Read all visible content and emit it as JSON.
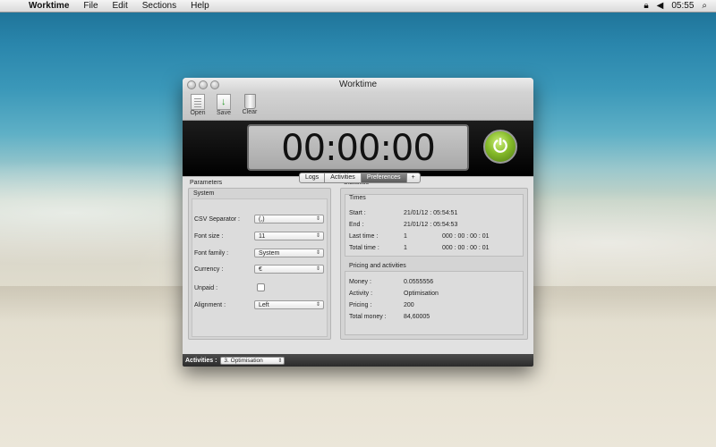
{
  "menubar": {
    "apple": "",
    "app_name": "Worktime",
    "items": [
      "File",
      "Edit",
      "Sections",
      "Help"
    ],
    "time": "05:55",
    "lock_icon": "lock-icon",
    "speaker_icon": "speaker-icon",
    "search_icon": "search-icon"
  },
  "window": {
    "title": "Worktime",
    "toolbar": {
      "open": "Open",
      "save": "Save",
      "clear": "Clear"
    },
    "timer": "00:00:00",
    "tabs": [
      "Logs",
      "Activities",
      "Preferences",
      "+"
    ],
    "parameters": {
      "title": "Parameters",
      "group": "System",
      "csv_label": "CSV Separator :",
      "csv_value": "(,)",
      "font_size_label": "Font size :",
      "font_size_value": "11",
      "font_family_label": "Font family :",
      "font_family_value": "System",
      "currency_label": "Currency :",
      "currency_value": "€",
      "unpaid_label": "Unpaid :",
      "alignment_label": "Alignment :",
      "alignment_value": "Left"
    },
    "statistics": {
      "title": "Statistics",
      "times_title": "Times",
      "start_label": "Start :",
      "start_value": "21/01/12 : 05:54:51",
      "end_label": "End :",
      "end_value": "21/01/12 : 05:54:53",
      "last_label": "Last time :",
      "last_count": "1",
      "last_value": "000 : 00 : 00 : 01",
      "total_label": "Total time :",
      "total_count": "1",
      "total_value": "000 : 00 : 00 : 01",
      "pricing_title": "Pricing and activities",
      "money_label": "Money :",
      "money_value": "0.0555556",
      "activity_label": "Activity :",
      "activity_value": "Optimisation",
      "pricing_label": "Pricing :",
      "pricing_value": "200",
      "total_money_label": "Total money :",
      "total_money_value": "84,60005"
    },
    "bottom": {
      "label": "Activities :",
      "selected": "3. Optimisation"
    }
  }
}
